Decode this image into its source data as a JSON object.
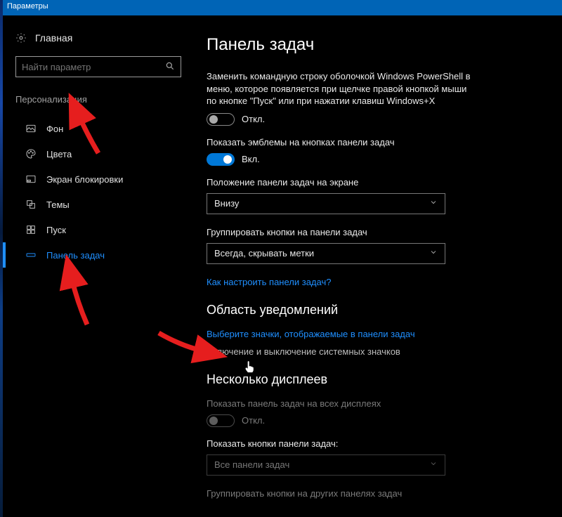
{
  "window": {
    "title": "Параметры"
  },
  "sidebar": {
    "home": "Главная",
    "search_placeholder": "Найти параметр",
    "category": "Персонализация",
    "items": [
      {
        "label": "Фон"
      },
      {
        "label": "Цвета"
      },
      {
        "label": "Экран блокировки"
      },
      {
        "label": "Темы"
      },
      {
        "label": "Пуск"
      },
      {
        "label": "Панель задач"
      }
    ]
  },
  "main": {
    "title": "Панель задач",
    "powershell_desc": "Заменить командную строку оболочкой Windows PowerShell в меню, которое появляется при щелчке правой кнопкой мыши по кнопке \"Пуск\" или при нажатии клавиш Windows+X",
    "off_label": "Откл.",
    "on_label": "Вкл.",
    "badges_label": "Показать эмблемы на кнопках панели задач",
    "location_label": "Положение панели задач на экране",
    "location_value": "Внизу",
    "grouping_label": "Группировать кнопки на панели задач",
    "grouping_value": "Всегда, скрывать метки",
    "customize_link": "Как настроить панели задач?",
    "notif_title": "Область уведомлений",
    "notif_link1": "Выберите значки, отображаемые в панели задач",
    "notif_link2": "Включение и выключение системных значков",
    "multi_title": "Несколько дисплеев",
    "multi_desc": "Показать панель задач на всех дисплеях",
    "multi_buttons_label": "Показать кнопки панели задач:",
    "multi_buttons_value": "Все панели задач",
    "multi_group_label": "Группировать кнопки на других панелях задач"
  }
}
